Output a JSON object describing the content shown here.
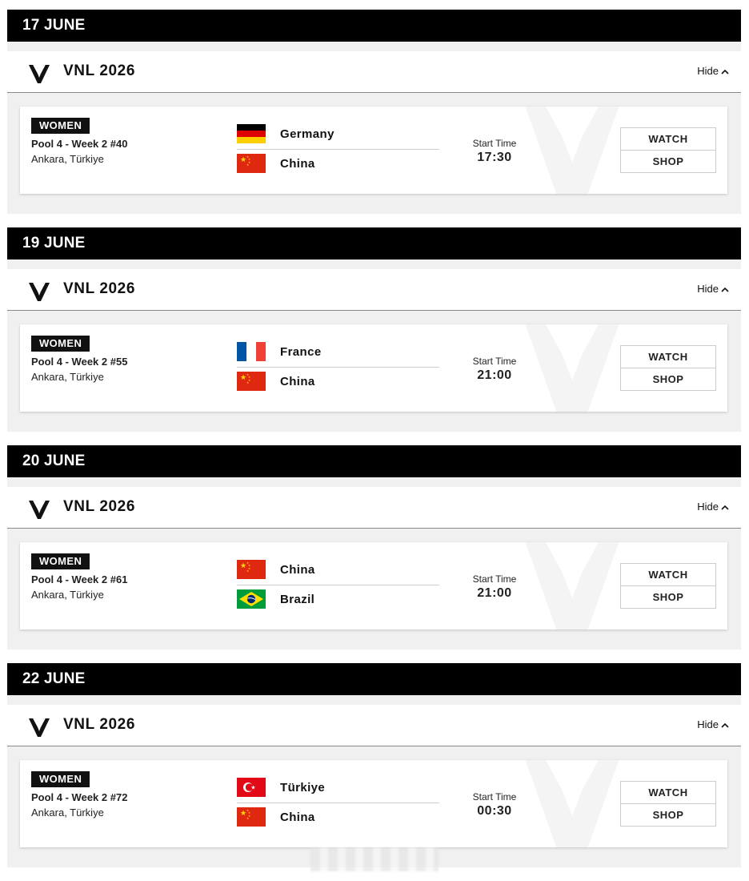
{
  "days": [
    {
      "date": "17 JUNE",
      "competition": "VNL 2026",
      "toggle_label": "Hide",
      "match": {
        "gender": "WOMEN",
        "pool": "Pool 4 - Week 2 #40",
        "location": "Ankara, Türkiye",
        "home": {
          "name": "Germany",
          "flag": "germany-flag"
        },
        "away": {
          "name": "China",
          "flag": "china-flag"
        },
        "start_label": "Start Time",
        "start_time": "17:30",
        "watch_label": "WATCH",
        "shop_label": "SHOP"
      }
    },
    {
      "date": "19 JUNE",
      "competition": "VNL 2026",
      "toggle_label": "Hide",
      "match": {
        "gender": "WOMEN",
        "pool": "Pool 4 - Week 2 #55",
        "location": "Ankara, Türkiye",
        "home": {
          "name": "France",
          "flag": "france-flag"
        },
        "away": {
          "name": "China",
          "flag": "china-flag"
        },
        "start_label": "Start Time",
        "start_time": "21:00",
        "watch_label": "WATCH",
        "shop_label": "SHOP"
      }
    },
    {
      "date": "20 JUNE",
      "competition": "VNL 2026",
      "toggle_label": "Hide",
      "match": {
        "gender": "WOMEN",
        "pool": "Pool 4 - Week 2 #61",
        "location": "Ankara, Türkiye",
        "home": {
          "name": "China",
          "flag": "china-flag"
        },
        "away": {
          "name": "Brazil",
          "flag": "brazil-flag"
        },
        "start_label": "Start Time",
        "start_time": "21:00",
        "watch_label": "WATCH",
        "shop_label": "SHOP"
      }
    },
    {
      "date": "22 JUNE",
      "competition": "VNL 2026",
      "toggle_label": "Hide",
      "match": {
        "gender": "WOMEN",
        "pool": "Pool 4 - Week 2 #72",
        "location": "Ankara, Türkiye",
        "home": {
          "name": "Türkiye",
          "flag": "turkiye-flag"
        },
        "away": {
          "name": "China",
          "flag": "china-flag"
        },
        "start_label": "Start Time",
        "start_time": "00:30",
        "watch_label": "WATCH",
        "shop_label": "SHOP"
      }
    }
  ],
  "icons": {
    "logo": "vnl-logo-icon",
    "toggle": "chevron-up-icon"
  },
  "colors": {
    "header_bg": "#000000",
    "panel_bg": "#f0f0f0",
    "badge_bg": "#111111"
  }
}
